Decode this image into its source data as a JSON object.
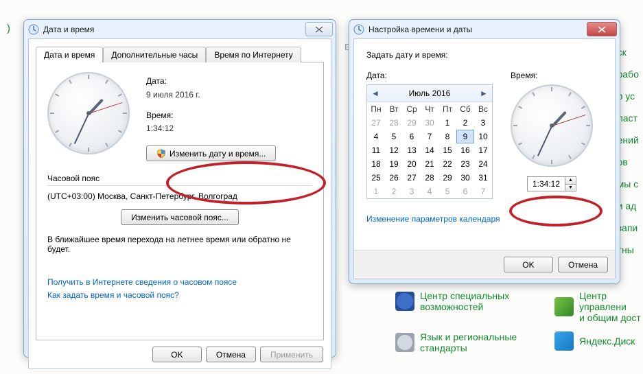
{
  "window1": {
    "title": "Дата и время",
    "tabs": [
      "Дата и время",
      "Дополнительные часы",
      "Время по Интернету"
    ],
    "date_label": "Дата:",
    "date_value": "9 июля 2016 г.",
    "time_label": "Время:",
    "time_value": "1:34:12",
    "change_datetime_btn": "Изменить дату и время...",
    "tz_section": "Часовой пояс",
    "tz_value": "(UTC+03:00) Москва, Санкт-Петербург, Волгоград",
    "change_tz_btn": "Изменить часовой пояс...",
    "dst_note": "В ближайшее время перехода на летнее время или обратно не будет.",
    "link_tzinfo": "Получить в Интернете сведения о часовом поясе",
    "link_howto": "Как задать время и часовой пояс?",
    "ok": "OK",
    "cancel": "Отмена",
    "apply": "Применить"
  },
  "window2": {
    "title": "Настройка времени и даты",
    "instruction": "Задать дату и время:",
    "date_label": "Дата:",
    "time_label": "Время:",
    "cal_title": "Июль 2016",
    "dow": [
      "Пн",
      "Вт",
      "Ср",
      "Чт",
      "Пт",
      "Сб",
      "Вс"
    ],
    "weeks": [
      [
        27,
        28,
        29,
        30,
        1,
        2,
        3
      ],
      [
        4,
        5,
        6,
        7,
        8,
        9,
        10
      ],
      [
        11,
        12,
        13,
        14,
        15,
        16,
        17
      ],
      [
        18,
        19,
        20,
        21,
        22,
        23,
        24
      ],
      [
        25,
        26,
        27,
        28,
        29,
        30,
        31
      ],
      [
        1,
        2,
        3,
        4,
        5,
        6,
        7
      ]
    ],
    "month_first_idx": 4,
    "month_last_idx": 34,
    "selected_day": 9,
    "today_day": 9,
    "time_value": "1:34:12",
    "cal_settings_link": "Изменение параметров календаря",
    "ok": "OK",
    "cancel": "Отмена"
  },
  "bg": {
    "accessibility": "Центр специальных\nвозможностей",
    "manage": "Центр управлени\nи общим дост",
    "lang": "Язык и региональные\nстандарты",
    "yadisk": "Яндекс.Диск",
    "frag_right": [
      "ск",
      "рабо",
      "р ус",
      "ласт",
      "ений",
      "ов",
      "мы с",
      "и ад",
      "запи",
      "тны"
    ]
  }
}
